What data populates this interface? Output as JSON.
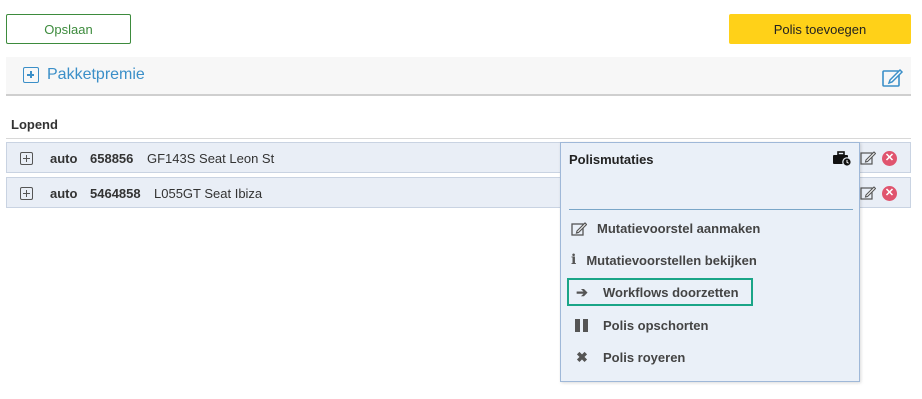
{
  "toolbar": {
    "save_label": "Opslaan",
    "add_policy_label": "Polis toevoegen"
  },
  "pakket": {
    "title": "Pakketpremie"
  },
  "section": {
    "label": "Lopend"
  },
  "policies": [
    {
      "type": "auto",
      "number": "658856",
      "description": "GF143S Seat Leon St"
    },
    {
      "type": "auto",
      "number": "5464858",
      "description": "L055GT Seat Ibiza"
    }
  ],
  "menu": {
    "title": "Polismutaties",
    "items": [
      {
        "label": "Mutatievoorstel aanmaken",
        "icon": "edit-icon"
      },
      {
        "label": "Mutatievoorstellen bekijken",
        "icon": "info-icon"
      },
      {
        "label": "Workflows doorzetten",
        "icon": "arrow-right-icon",
        "highlighted": true
      },
      {
        "label": "Polis opschorten",
        "icon": "pause-icon"
      },
      {
        "label": "Polis royeren",
        "icon": "close-icon"
      }
    ]
  },
  "colors": {
    "accent_blue": "#3b8fc8",
    "save_green": "#3d8b3d",
    "add_yellow": "#ffd118",
    "highlight_teal": "#1aa587",
    "delete_red": "#e0546e"
  }
}
